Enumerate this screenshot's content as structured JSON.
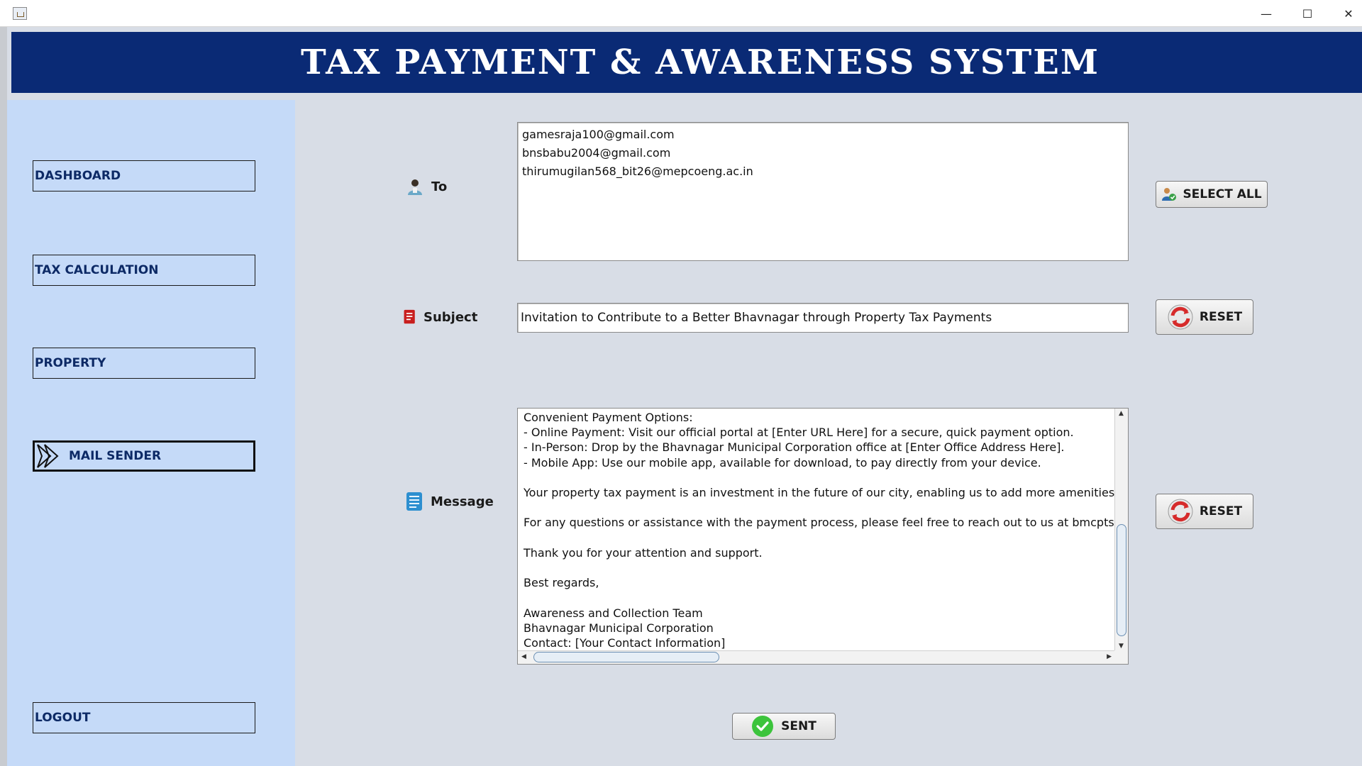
{
  "window": {
    "minimize": "—",
    "maximize": "☐",
    "close": "✕"
  },
  "header": {
    "title": "TAX PAYMENT & AWARENESS SYSTEM"
  },
  "sidebar": {
    "items": [
      {
        "label": "DASHBOARD"
      },
      {
        "label": "TAX CALCULATION"
      },
      {
        "label": "PROPERTY"
      },
      {
        "label": "MAIL SENDER",
        "active": true
      },
      {
        "label": "LOGOUT"
      }
    ]
  },
  "form": {
    "to_label": "To",
    "to_recipients": [
      "gamesraja100@gmail.com",
      "bnsbabu2004@gmail.com",
      "thirumugilan568_bit26@mepcoeng.ac.in"
    ],
    "subject_label": "Subject",
    "subject_value": "Invitation to Contribute to a Better Bhavnagar through Property Tax Payments",
    "message_label": "Message",
    "message_value": "Convenient Payment Options:\n- Online Payment: Visit our official portal at [Enter URL Here] for a secure, quick payment option.\n- In-Person: Drop by the Bhavnagar Municipal Corporation office at [Enter Office Address Here].\n- Mobile App: Use our mobile app, available for download, to pay directly from your device.\n\nYour property tax payment is an investment in the future of our city, enabling us to add more amenities a\n\nFor any questions or assistance with the payment process, please feel free to reach out to us at bmcptsce\n\nThank you for your attention and support.\n\nBest regards,\n\nAwareness and Collection Team\nBhavnagar Municipal Corporation\nContact: [Your Contact Information]"
  },
  "buttons": {
    "select_all": "SELECT ALL",
    "reset_subject": "RESET",
    "reset_message": "RESET",
    "send": "SENT"
  },
  "colors": {
    "header_bg": "#0a2a75",
    "sidebar_bg": "#c5daf8",
    "content_bg": "#d8dde6",
    "nav_text": "#0d2a66"
  }
}
